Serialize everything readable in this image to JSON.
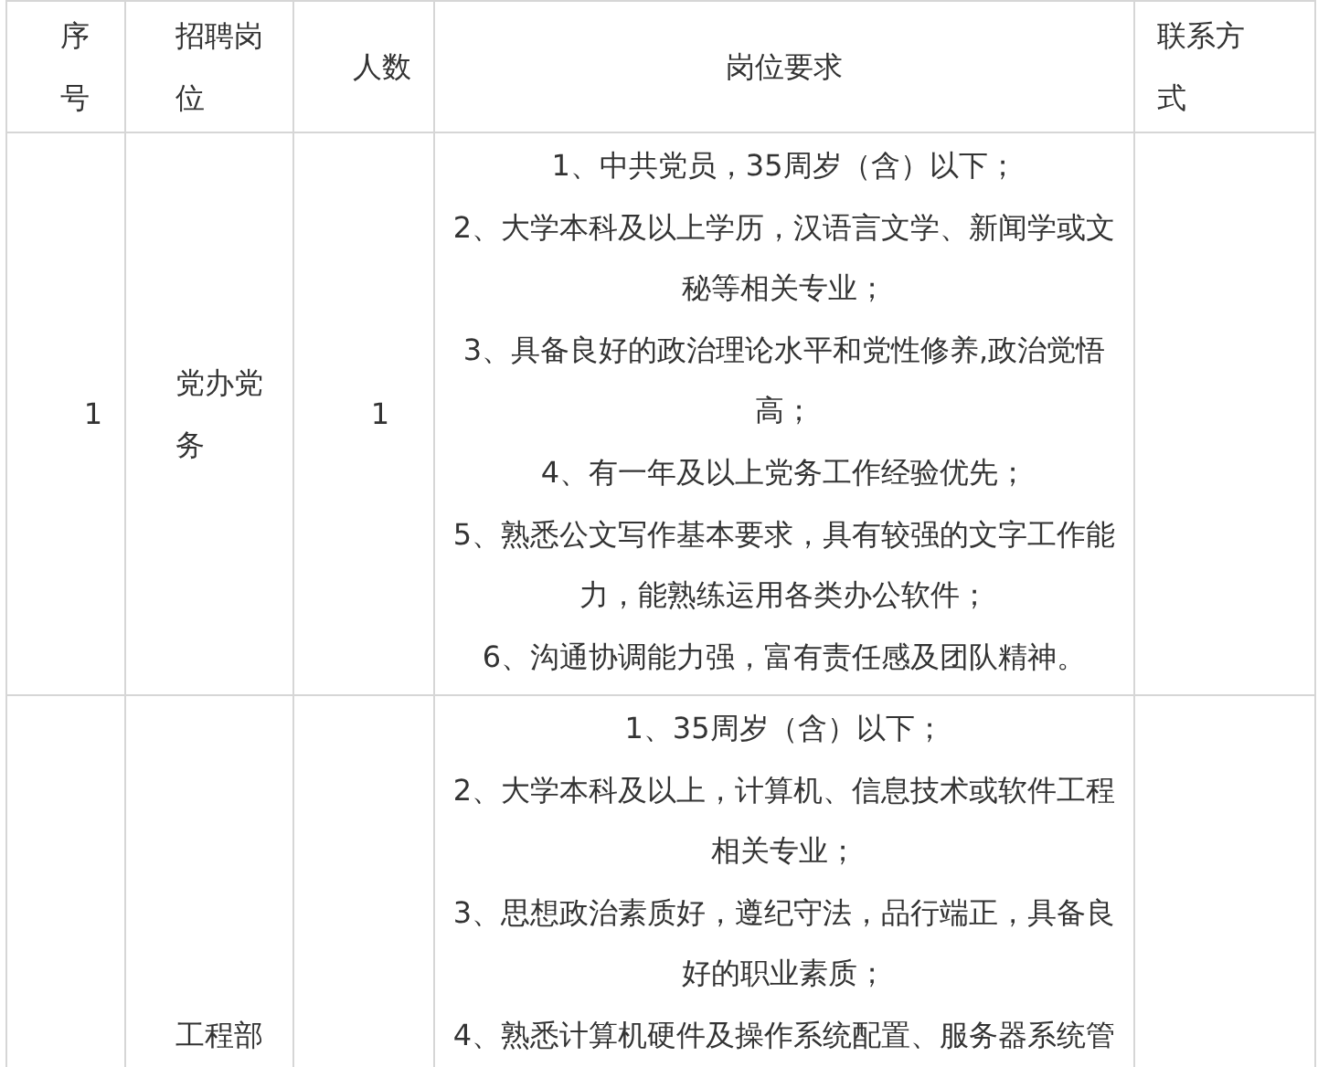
{
  "table": {
    "columns": [
      "序号",
      "招聘岗位",
      "人数",
      "岗位要求",
      "联系方式"
    ],
    "rows": [
      {
        "number": "1",
        "position": "党办党务",
        "count": "1",
        "requirements": [
          "1、中共党员，35周岁（含）以下；",
          "2、大学本科及以上学历，汉语言文学、新闻学或文秘等相关专业；",
          "3、具备良好的政治理论水平和党性修养,政治觉悟高；",
          "4、有一年及以上党务工作经验优先；",
          "5、熟悉公文写作基本要求，具有较强的文字工作能力，能熟练运用各类办公软件；",
          "6、沟通协调能力强，富有责任感及团队精神。"
        ]
      },
      {
        "position": "工程部",
        "requirements": [
          "1、35周岁（含）以下；",
          "2、大学本科及以上，计算机、信息技术或软件工程相关专业；",
          "3、思想政治素质好，遵纪守法，品行端正，具备良好的职业素质；",
          "4、熟悉计算机硬件及操作系统配置、服务器系统管"
        ]
      }
    ]
  }
}
